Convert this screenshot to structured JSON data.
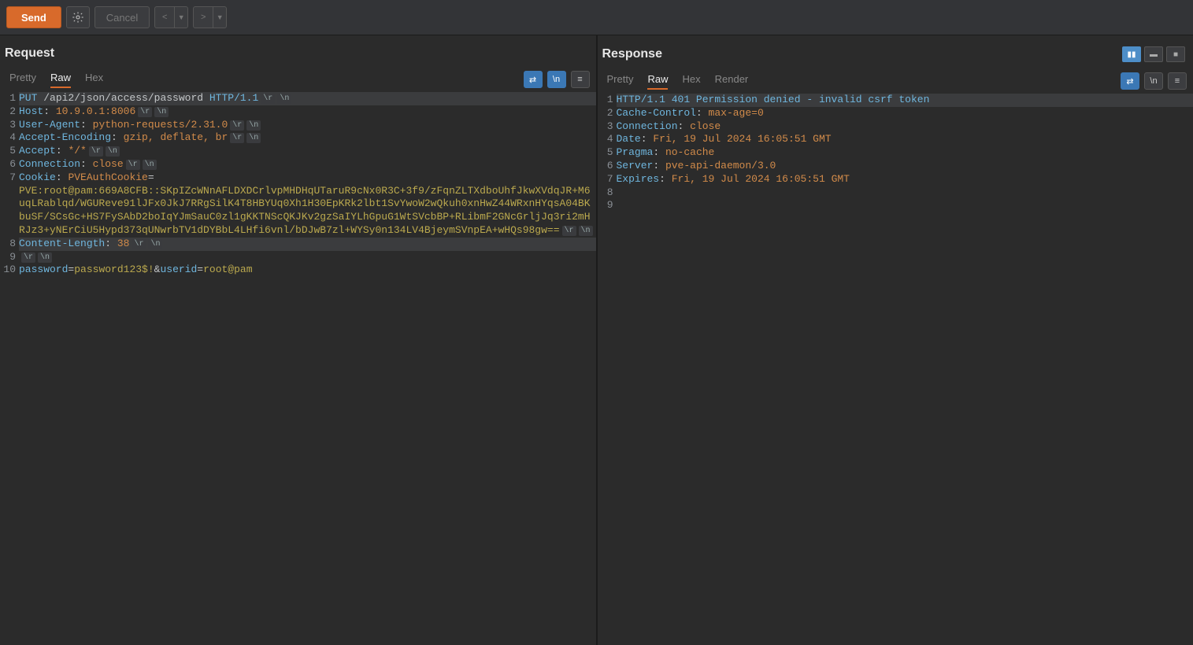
{
  "toolbar": {
    "send": "Send",
    "cancel": "Cancel"
  },
  "layoutToggle": {
    "activeIndex": 0
  },
  "request": {
    "title": "Request",
    "tabs": {
      "pretty": "Pretty",
      "raw": "Raw",
      "hex": "Hex",
      "active": "Raw"
    },
    "statusLine": {
      "method": "PUT",
      "path": "/api2/json/access/password",
      "proto": "HTTP/1.1"
    },
    "headers": [
      {
        "name": "Host",
        "value": "10.9.0.1:8006"
      },
      {
        "name": "User-Agent",
        "value": "python-requests/2.31.0"
      },
      {
        "name": "Accept-Encoding",
        "value": "gzip, deflate, br"
      },
      {
        "name": "Accept",
        "value": "*/*"
      },
      {
        "name": "Connection",
        "value": "close"
      }
    ],
    "cookie": {
      "name": "Cookie",
      "cookieKey": "PVEAuthCookie",
      "cookieValue": "PVE:root@pam:669A8CFB::SKpIZcWNnAFLDXDCrlvpMHDHqUTaruR9cNx0R3C+3f9/zFqnZLTXdboUhfJkwXVdqJR+M6uqLRablqd/WGUReve91lJFx0JkJ7RRgSilK4T8HBYUq0Xh1H30EpKRk2lbt1SvYwoW2wQkuh0xnHwZ44WRxnHYqsA04BKbuSF/SCsGc+HS7FySAbD2boIqYJmSauC0zl1gKKTNScQKJKv2gzSaIYLhGpuG1WtSVcbBP+RLibmF2GNcGrljJq3ri2mHRJz3+yNErCiU5Hypd373qUNwrbTV1dDYBbL4LHfi6vnl/bDJwB7zl+WYSy0n134LV4BjeymSVnpEA+wHQs98gw=="
    },
    "contentLength": {
      "name": "Content-Length",
      "value": "38"
    },
    "body": {
      "params": [
        {
          "key": "password",
          "value": "password123$!"
        },
        {
          "key": "userid",
          "value": "root@pam"
        }
      ]
    },
    "lineNumbers": [
      "1",
      "2",
      "3",
      "4",
      "5",
      "6",
      "7",
      "",
      "",
      "",
      "",
      "8",
      "9",
      "10"
    ]
  },
  "response": {
    "title": "Response",
    "tabs": {
      "pretty": "Pretty",
      "raw": "Raw",
      "hex": "Hex",
      "render": "Render",
      "active": "Raw"
    },
    "statusLine": "HTTP/1.1 401 Permission denied - invalid csrf token",
    "headers": [
      {
        "name": "Cache-Control",
        "value": "max-age=0"
      },
      {
        "name": "Connection",
        "value": "close"
      },
      {
        "name": "Date",
        "value": "Fri, 19 Jul 2024 16:05:51 GMT"
      },
      {
        "name": "Pragma",
        "value": "no-cache"
      },
      {
        "name": "Server",
        "value": "pve-api-daemon/3.0"
      },
      {
        "name": "Expires",
        "value": "Fri, 19 Jul 2024 16:05:51 GMT"
      }
    ],
    "lineNumbers": [
      "1",
      "2",
      "3",
      "4",
      "5",
      "6",
      "7",
      "8",
      "9"
    ]
  },
  "crlf": {
    "r": "\\r",
    "n": "\\n"
  }
}
